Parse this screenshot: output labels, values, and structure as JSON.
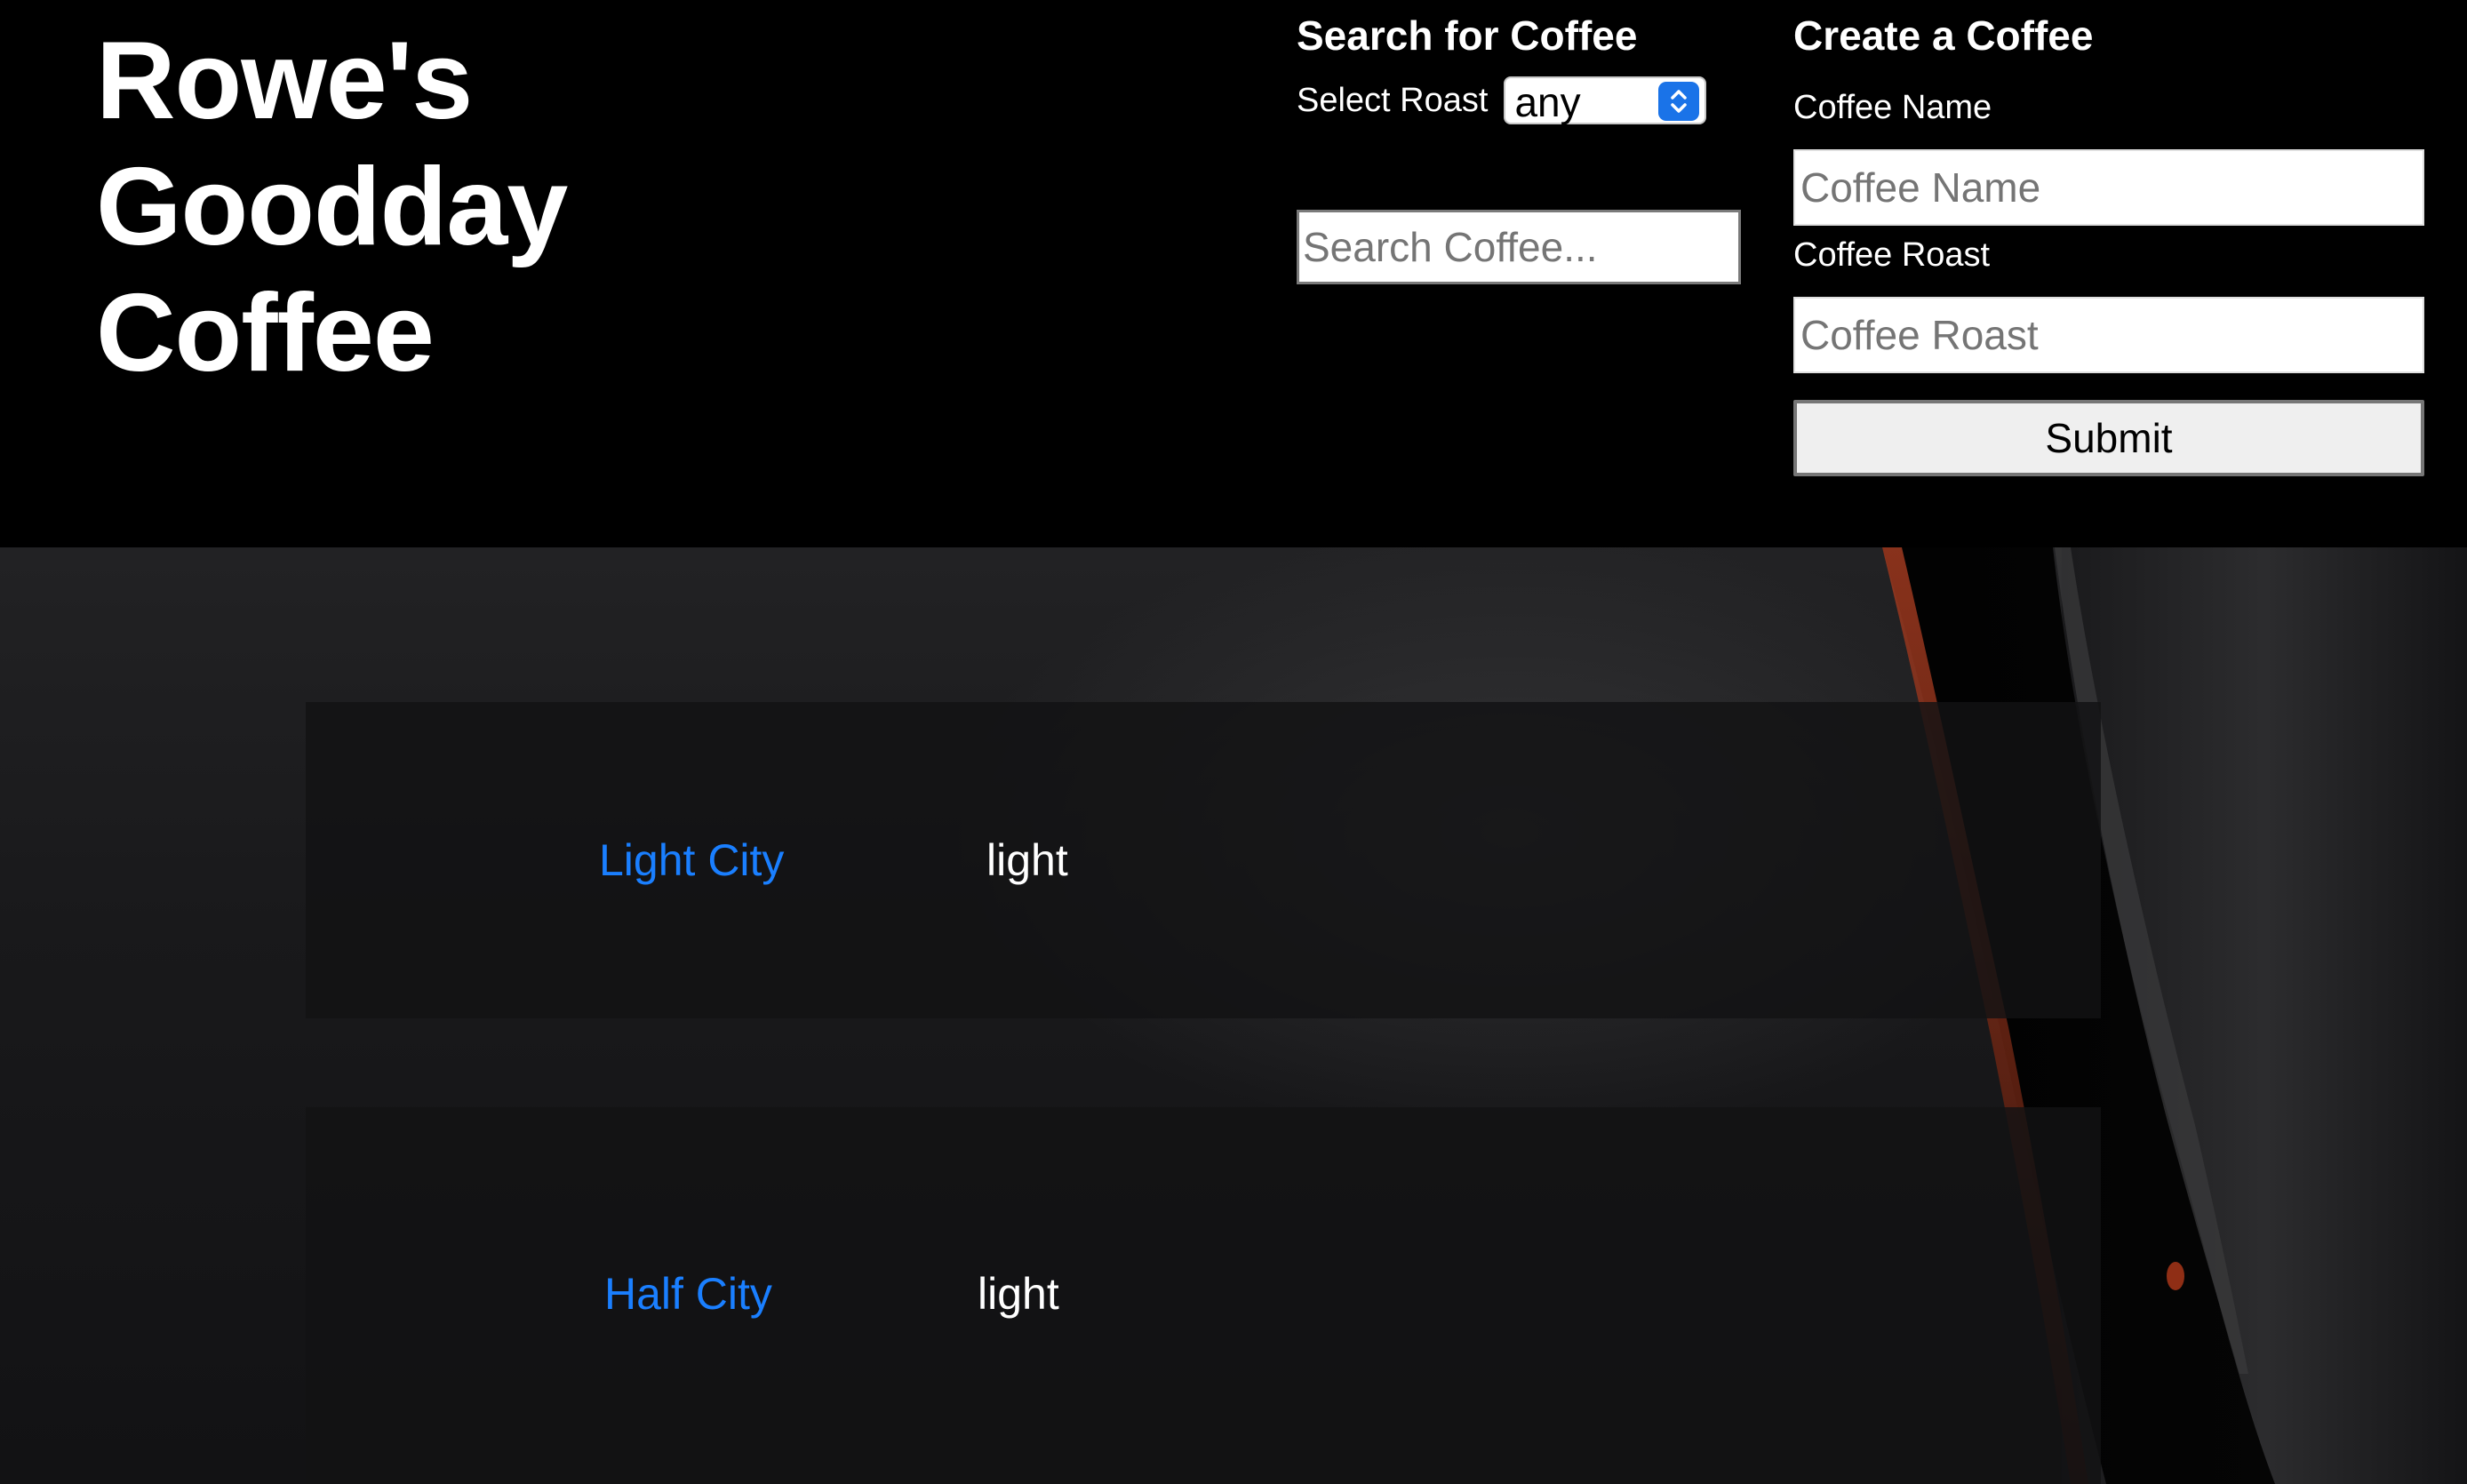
{
  "site": {
    "title": "Rowe's Goodday Coffee"
  },
  "search": {
    "heading": "Search for Coffee",
    "roast_label": "Select Roast",
    "roast_selected": "any",
    "placeholder": "Search Coffee..."
  },
  "create": {
    "heading": "Create a Coffee",
    "name_label": "Coffee Name",
    "name_placeholder": "Coffee Name",
    "roast_label": "Coffee Roast",
    "roast_placeholder": "Coffee Roast",
    "submit_label": "Submit"
  },
  "coffees": [
    {
      "name": "Light City",
      "roast": "light"
    },
    {
      "name": "Half City",
      "roast": "light"
    }
  ],
  "colors": {
    "link": "#1a7fff",
    "header_bg": "#000000",
    "select_accent": "#1a73e8"
  }
}
